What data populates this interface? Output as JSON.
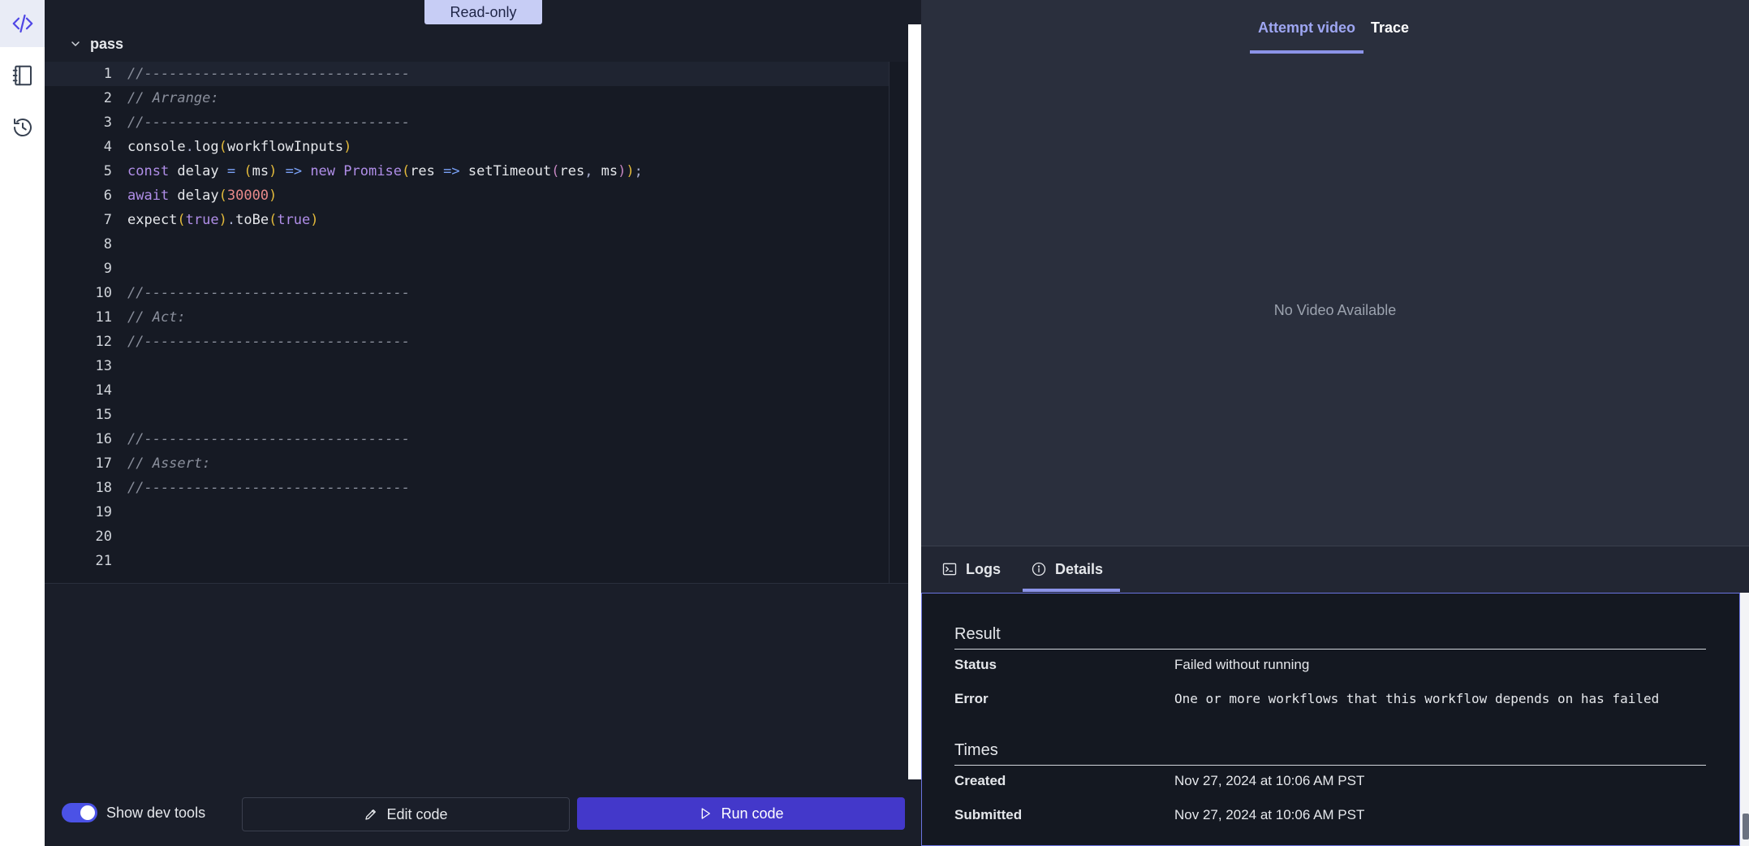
{
  "editor": {
    "readonly_badge": "Read-only",
    "file_name": "pass",
    "lines": [
      {
        "n": "1",
        "tokens": [
          {
            "t": "//--------------------------------",
            "c": "t-cmt"
          }
        ]
      },
      {
        "n": "2",
        "tokens": [
          {
            "t": "// Arrange:",
            "c": "t-cmt"
          }
        ]
      },
      {
        "n": "3",
        "tokens": [
          {
            "t": "//--------------------------------",
            "c": "t-cmt"
          }
        ]
      },
      {
        "n": "4",
        "tokens": [
          {
            "t": "console",
            "c": ""
          },
          {
            "t": ".",
            "c": "t-punct"
          },
          {
            "t": "log",
            "c": ""
          },
          {
            "t": "(",
            "c": "t-paren"
          },
          {
            "t": "workflowInputs",
            "c": ""
          },
          {
            "t": ")",
            "c": "t-paren"
          }
        ]
      },
      {
        "n": "5",
        "tokens": [
          {
            "t": "const",
            "c": "t-kw"
          },
          {
            "t": " delay ",
            "c": ""
          },
          {
            "t": "=",
            "c": "t-op"
          },
          {
            "t": " ",
            "c": ""
          },
          {
            "t": "(",
            "c": "t-paren"
          },
          {
            "t": "ms",
            "c": ""
          },
          {
            "t": ")",
            "c": "t-paren"
          },
          {
            "t": " ",
            "c": ""
          },
          {
            "t": "=>",
            "c": "t-op"
          },
          {
            "t": " ",
            "c": ""
          },
          {
            "t": "new",
            "c": "t-kw"
          },
          {
            "t": " ",
            "c": ""
          },
          {
            "t": "Promise",
            "c": "t-cls"
          },
          {
            "t": "(",
            "c": "t-paren"
          },
          {
            "t": "res ",
            "c": ""
          },
          {
            "t": "=>",
            "c": "t-op"
          },
          {
            "t": " setTimeout",
            "c": ""
          },
          {
            "t": "(",
            "c": "t-paren2"
          },
          {
            "t": "res",
            "c": ""
          },
          {
            "t": ",",
            "c": "t-punct"
          },
          {
            "t": " ms",
            "c": ""
          },
          {
            "t": ")",
            "c": "t-paren2"
          },
          {
            "t": ")",
            "c": "t-paren"
          },
          {
            "t": ";",
            "c": "t-punct"
          }
        ]
      },
      {
        "n": "6",
        "tokens": [
          {
            "t": "await",
            "c": "t-kw"
          },
          {
            "t": " delay",
            "c": ""
          },
          {
            "t": "(",
            "c": "t-paren"
          },
          {
            "t": "30000",
            "c": "t-num"
          },
          {
            "t": ")",
            "c": "t-paren"
          }
        ]
      },
      {
        "n": "7",
        "tokens": [
          {
            "t": "expect",
            "c": ""
          },
          {
            "t": "(",
            "c": "t-paren"
          },
          {
            "t": "true",
            "c": "t-kw"
          },
          {
            "t": ")",
            "c": "t-paren"
          },
          {
            "t": ".",
            "c": "t-punct"
          },
          {
            "t": "toBe",
            "c": ""
          },
          {
            "t": "(",
            "c": "t-paren"
          },
          {
            "t": "true",
            "c": "t-kw"
          },
          {
            "t": ")",
            "c": "t-paren"
          }
        ]
      },
      {
        "n": "8",
        "tokens": []
      },
      {
        "n": "9",
        "tokens": []
      },
      {
        "n": "10",
        "tokens": [
          {
            "t": "//--------------------------------",
            "c": "t-cmt"
          }
        ]
      },
      {
        "n": "11",
        "tokens": [
          {
            "t": "// Act:",
            "c": "t-cmt"
          }
        ]
      },
      {
        "n": "12",
        "tokens": [
          {
            "t": "//--------------------------------",
            "c": "t-cmt"
          }
        ]
      },
      {
        "n": "13",
        "tokens": []
      },
      {
        "n": "14",
        "tokens": []
      },
      {
        "n": "15",
        "tokens": []
      },
      {
        "n": "16",
        "tokens": [
          {
            "t": "//--------------------------------",
            "c": "t-cmt"
          }
        ]
      },
      {
        "n": "17",
        "tokens": [
          {
            "t": "// Assert:",
            "c": "t-cmt"
          }
        ]
      },
      {
        "n": "18",
        "tokens": [
          {
            "t": "//--------------------------------",
            "c": "t-cmt"
          }
        ]
      },
      {
        "n": "19",
        "tokens": []
      },
      {
        "n": "20",
        "tokens": []
      },
      {
        "n": "21",
        "tokens": []
      }
    ]
  },
  "footer": {
    "toggle_label": "Show dev tools",
    "toggle_on": true,
    "edit_button": "Edit code",
    "run_button": "Run code"
  },
  "media": {
    "tabs": [
      "Attempt video",
      "Trace"
    ],
    "active_tab": "Attempt video",
    "empty_message": "No Video Available"
  },
  "bottom_tabs": {
    "logs": "Logs",
    "details": "Details",
    "active_tab": "Details"
  },
  "details": {
    "result_title": "Result",
    "status_label": "Status",
    "status_value": "Failed without running",
    "error_label": "Error",
    "error_value": "One or more workflows that this workflow depends on has failed",
    "times_title": "Times",
    "created_label": "Created",
    "created_value": "Nov 27, 2024 at 10:06 AM PST",
    "submitted_label": "Submitted",
    "submitted_value": "Nov 27, 2024 at 10:06 AM PST"
  },
  "colors": {
    "accent": "#4338ca",
    "tab_underline": "#8b93e8",
    "toggle": "#4b52e6"
  },
  "icons": {
    "rail": [
      "code-icon",
      "notebook-icon",
      "history-icon"
    ],
    "logs": "terminal-icon",
    "details": "info-icon",
    "edit": "pencil-icon",
    "run": "play-icon"
  }
}
